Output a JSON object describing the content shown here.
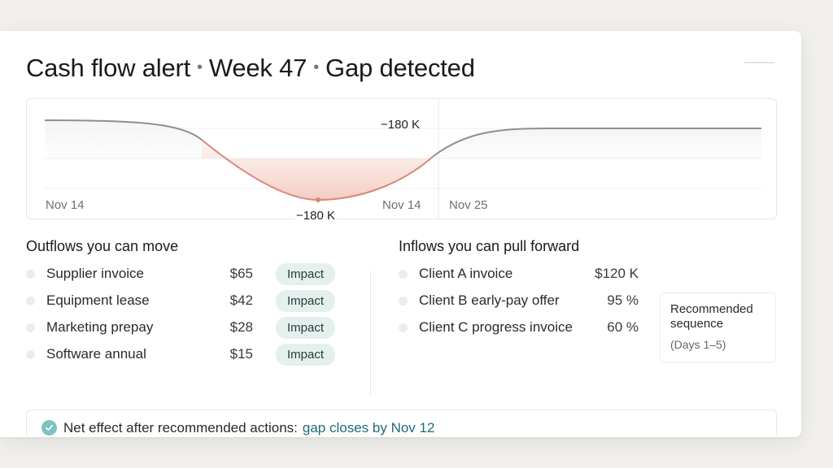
{
  "header": {
    "title_part1": "Cash flow alert",
    "title_part2": "Week 47",
    "title_part3": "Gap detected",
    "separator": "•"
  },
  "chart": {
    "label_left": "Nov 14",
    "label_mid": "Nov 14",
    "label_right": "Nov 25",
    "value_top": "−180 K",
    "value_bottom": "−180 K",
    "colors": {
      "line": "#8f8f8f",
      "gap_line": "#d8887a",
      "gap_fill": "#f4cdc4"
    }
  },
  "outflows": {
    "title": "Outflows you can move",
    "items": [
      {
        "label": "Supplier invoice",
        "amount": "$65",
        "action": "Impact"
      },
      {
        "label": "Equipment lease",
        "amount": "$42",
        "action": "Impact"
      },
      {
        "label": "Marketing prepay",
        "amount": "$28",
        "action": "Impact"
      },
      {
        "label": "Software annual",
        "amount": "$15",
        "action": "Impact"
      }
    ]
  },
  "inflows": {
    "title": "Inflows you can pull forward",
    "items": [
      {
        "label": "Client A invoice",
        "amount": "$120 K"
      },
      {
        "label": "Client B early-pay offer",
        "amount": "95 %"
      },
      {
        "label": "Client C progress invoice",
        "amount": "60 %"
      }
    ]
  },
  "recommendation": {
    "title": "Recommended sequence",
    "subtitle": "(Days 1–5)"
  },
  "net_effect": {
    "prefix": "Net effect after recommended actions:",
    "highlight": "gap closes by Nov 12",
    "icon": "check-circle-icon",
    "accent": "#7cc3c2"
  }
}
